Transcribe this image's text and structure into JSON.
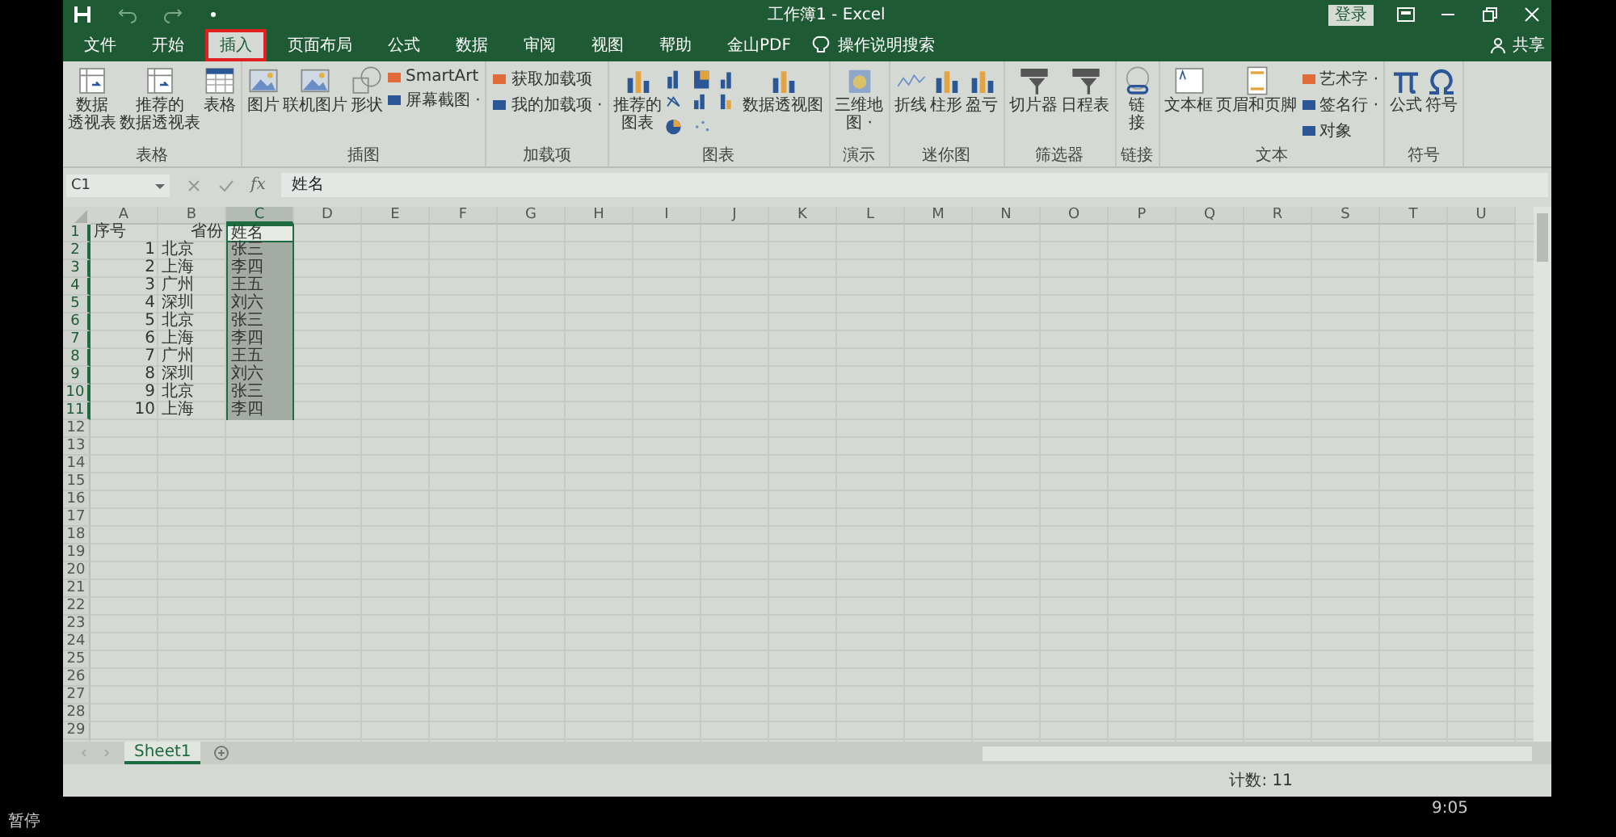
{
  "window": {
    "title": "工作簿1 - Excel",
    "sign_in": "登录"
  },
  "tabs": [
    {
      "label": "文件",
      "selected": false,
      "annotated": false
    },
    {
      "label": "开始",
      "selected": false,
      "annotated": false
    },
    {
      "label": "插入",
      "selected": true,
      "annotated": true
    },
    {
      "label": "页面布局",
      "selected": false,
      "annotated": false
    },
    {
      "label": "公式",
      "selected": false,
      "annotated": false
    },
    {
      "label": "数据",
      "selected": false,
      "annotated": false
    },
    {
      "label": "审阅",
      "selected": false,
      "annotated": false
    },
    {
      "label": "视图",
      "selected": false,
      "annotated": false
    },
    {
      "label": "帮助",
      "selected": false,
      "annotated": false
    },
    {
      "label": "金山PDF",
      "selected": false,
      "annotated": false
    }
  ],
  "tell_me": "操作说明搜索",
  "share": "共享",
  "ribbon": [
    {
      "name": "表格",
      "items": [
        {
          "kind": "large",
          "lines": [
            "数据",
            "透视表"
          ]
        },
        {
          "kind": "large",
          "lines": [
            "推荐的",
            "数据透视表"
          ]
        },
        {
          "kind": "large",
          "lines": [
            "表格"
          ]
        }
      ]
    },
    {
      "name": "插图",
      "items": [
        {
          "kind": "large",
          "lines": [
            "图片"
          ]
        },
        {
          "kind": "large",
          "lines": [
            "联机图片"
          ]
        },
        {
          "kind": "large",
          "lines": [
            "形状"
          ]
        },
        {
          "kind": "stack",
          "entries": [
            "SmartArt",
            "屏幕截图 ·"
          ]
        }
      ]
    },
    {
      "name": "加载项",
      "items": [
        {
          "kind": "stack",
          "entries": [
            "获取加载项",
            "我的加载项 ·"
          ]
        }
      ]
    },
    {
      "name": "图表",
      "items": [
        {
          "kind": "large",
          "lines": [
            "推荐的",
            "图表"
          ]
        },
        {
          "kind": "chart_grid"
        },
        {
          "kind": "large",
          "lines": [
            "数据透视图"
          ]
        }
      ]
    },
    {
      "name": "演示",
      "items": [
        {
          "kind": "large",
          "lines": [
            "三维地",
            "图 ·"
          ]
        }
      ]
    },
    {
      "name": "迷你图",
      "items": [
        {
          "kind": "large",
          "lines": [
            "折线"
          ]
        },
        {
          "kind": "large",
          "lines": [
            "柱形"
          ]
        },
        {
          "kind": "large",
          "lines": [
            "盈亏"
          ]
        }
      ]
    },
    {
      "name": "筛选器",
      "items": [
        {
          "kind": "large",
          "lines": [
            "切片器"
          ]
        },
        {
          "kind": "large",
          "lines": [
            "日程表"
          ]
        }
      ]
    },
    {
      "name": "链接",
      "items": [
        {
          "kind": "large",
          "lines": [
            "链",
            "接"
          ]
        }
      ]
    },
    {
      "name": "文本",
      "items": [
        {
          "kind": "large",
          "lines": [
            "文本框"
          ]
        },
        {
          "kind": "large",
          "lines": [
            "页眉和页脚"
          ]
        },
        {
          "kind": "stack",
          "entries": [
            "艺术字 ·",
            "签名行 ·",
            "对象"
          ]
        }
      ]
    },
    {
      "name": "符号",
      "items": [
        {
          "kind": "large",
          "lines": [
            "公式"
          ]
        },
        {
          "kind": "large",
          "lines": [
            "符号"
          ]
        }
      ]
    }
  ],
  "formula_bar": {
    "name_box": "C1",
    "fx": "fx",
    "value": "姓名"
  },
  "sheet": {
    "columns": [
      {
        "label": "A",
        "selected": false
      },
      {
        "label": "B",
        "selected": false
      },
      {
        "label": "C",
        "selected": true
      },
      {
        "label": "D",
        "selected": false
      },
      {
        "label": "E",
        "selected": false
      },
      {
        "label": "F",
        "selected": false
      },
      {
        "label": "G",
        "selected": false
      },
      {
        "label": "H",
        "selected": false
      },
      {
        "label": "I",
        "selected": false
      },
      {
        "label": "J",
        "selected": false
      },
      {
        "label": "K",
        "selected": false
      },
      {
        "label": "L",
        "selected": false
      },
      {
        "label": "M",
        "selected": false
      },
      {
        "label": "N",
        "selected": false
      },
      {
        "label": "O",
        "selected": false
      },
      {
        "label": "P",
        "selected": false
      },
      {
        "label": "Q",
        "selected": false
      },
      {
        "label": "R",
        "selected": false
      },
      {
        "label": "S",
        "selected": false
      },
      {
        "label": "T",
        "selected": false
      },
      {
        "label": "U",
        "selected": false
      }
    ],
    "rows": [
      {
        "number": "1",
        "selected": true,
        "cells": [
          {
            "text": "序号",
            "kind": "text"
          },
          {
            "text": "省份",
            "kind": "text_right"
          },
          {
            "text": "姓名",
            "kind": "text"
          }
        ]
      },
      {
        "number": "2",
        "selected": true,
        "cells": [
          {
            "text": "1",
            "kind": "number"
          },
          {
            "text": "北京",
            "kind": "text"
          },
          {
            "text": "张三",
            "kind": "text"
          }
        ]
      },
      {
        "number": "3",
        "selected": true,
        "cells": [
          {
            "text": "2",
            "kind": "number"
          },
          {
            "text": "上海",
            "kind": "text"
          },
          {
            "text": "李四",
            "kind": "text"
          }
        ]
      },
      {
        "number": "4",
        "selected": true,
        "cells": [
          {
            "text": "3",
            "kind": "number"
          },
          {
            "text": "广州",
            "kind": "text"
          },
          {
            "text": "王五",
            "kind": "text"
          }
        ]
      },
      {
        "number": "5",
        "selected": true,
        "cells": [
          {
            "text": "4",
            "kind": "number"
          },
          {
            "text": "深圳",
            "kind": "text"
          },
          {
            "text": "刘六",
            "kind": "text"
          }
        ]
      },
      {
        "number": "6",
        "selected": true,
        "cells": [
          {
            "text": "5",
            "kind": "number"
          },
          {
            "text": "北京",
            "kind": "text"
          },
          {
            "text": "张三",
            "kind": "text"
          }
        ]
      },
      {
        "number": "7",
        "selected": true,
        "cells": [
          {
            "text": "6",
            "kind": "number"
          },
          {
            "text": "上海",
            "kind": "text"
          },
          {
            "text": "李四",
            "kind": "text"
          }
        ]
      },
      {
        "number": "8",
        "selected": true,
        "cells": [
          {
            "text": "7",
            "kind": "number"
          },
          {
            "text": "广州",
            "kind": "text"
          },
          {
            "text": "王五",
            "kind": "text"
          }
        ]
      },
      {
        "number": "9",
        "selected": true,
        "cells": [
          {
            "text": "8",
            "kind": "number"
          },
          {
            "text": "深圳",
            "kind": "text"
          },
          {
            "text": "刘六",
            "kind": "text"
          }
        ]
      },
      {
        "number": "10",
        "selected": true,
        "cells": [
          {
            "text": "9",
            "kind": "number"
          },
          {
            "text": "北京",
            "kind": "text"
          },
          {
            "text": "张三",
            "kind": "text"
          }
        ]
      },
      {
        "number": "11",
        "selected": true,
        "cells": [
          {
            "text": "10",
            "kind": "number"
          },
          {
            "text": "上海",
            "kind": "text"
          },
          {
            "text": "李四",
            "kind": "text"
          }
        ]
      },
      {
        "number": "12",
        "selected": false,
        "cells": []
      },
      {
        "number": "13",
        "selected": false,
        "cells": []
      },
      {
        "number": "14",
        "selected": false,
        "cells": []
      },
      {
        "number": "15",
        "selected": false,
        "cells": []
      },
      {
        "number": "16",
        "selected": false,
        "cells": []
      },
      {
        "number": "17",
        "selected": false,
        "cells": []
      },
      {
        "number": "18",
        "selected": false,
        "cells": []
      },
      {
        "number": "19",
        "selected": false,
        "cells": []
      },
      {
        "number": "20",
        "selected": false,
        "cells": []
      },
      {
        "number": "21",
        "selected": false,
        "cells": []
      },
      {
        "number": "22",
        "selected": false,
        "cells": []
      },
      {
        "number": "23",
        "selected": false,
        "cells": []
      },
      {
        "number": "24",
        "selected": false,
        "cells": []
      },
      {
        "number": "25",
        "selected": false,
        "cells": []
      },
      {
        "number": "26",
        "selected": false,
        "cells": []
      },
      {
        "number": "27",
        "selected": false,
        "cells": []
      },
      {
        "number": "28",
        "selected": false,
        "cells": []
      },
      {
        "number": "29",
        "selected": false,
        "cells": []
      }
    ]
  },
  "sheet_tabs": [
    {
      "label": "Sheet1",
      "selected": true
    }
  ],
  "status_bar": {
    "text": "计数: 11"
  },
  "player": {
    "state": "暂停",
    "time": "9:05"
  }
}
